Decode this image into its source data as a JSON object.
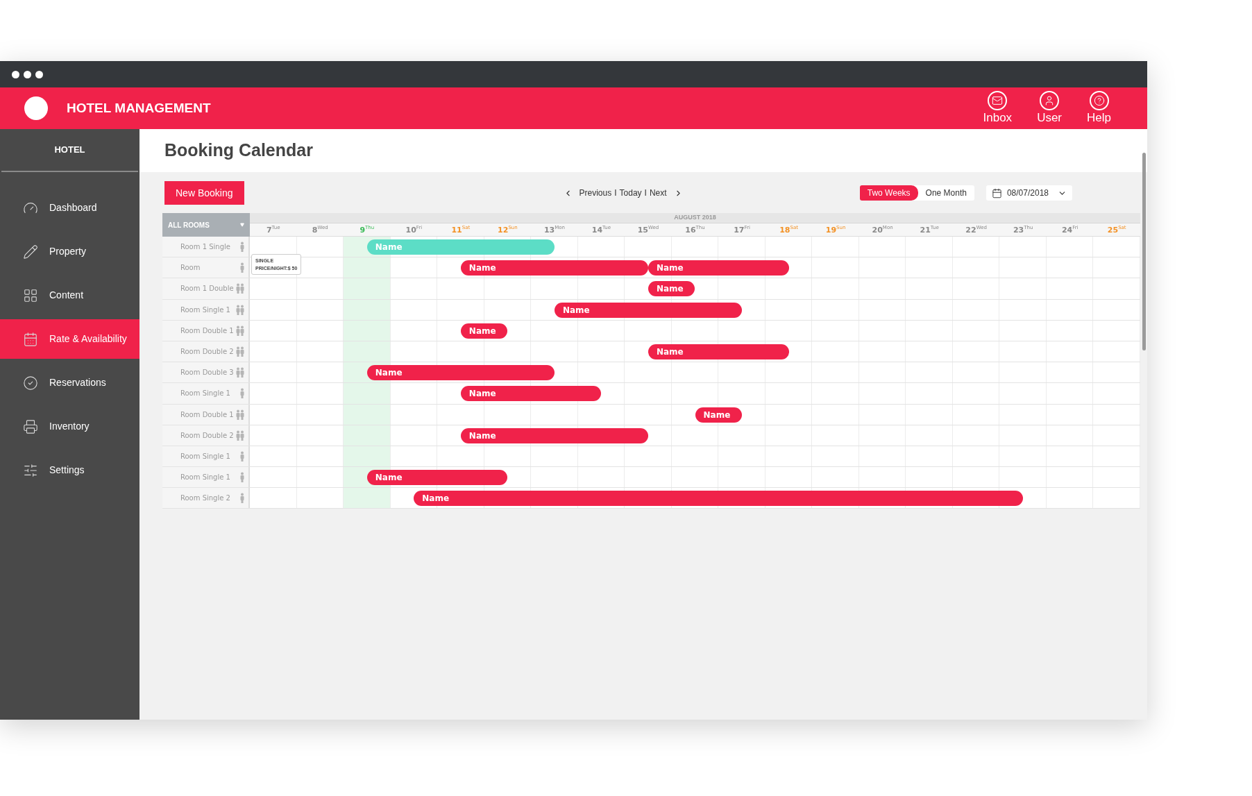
{
  "app": {
    "title": "HOTEL MANAGEMENT"
  },
  "header_actions": [
    {
      "label": "Inbox",
      "kind": "inbox"
    },
    {
      "label": "User",
      "kind": "user"
    },
    {
      "label": "Help",
      "kind": "help"
    }
  ],
  "sidebar": {
    "title": "HOTEL",
    "items": [
      {
        "label": "Dashboard",
        "kind": "dashboard",
        "selected": false
      },
      {
        "label": "Property",
        "kind": "property",
        "selected": false
      },
      {
        "label": "Content",
        "kind": "content",
        "selected": false
      },
      {
        "label": "Rate & Availability",
        "kind": "rate",
        "selected": true
      },
      {
        "label": "Reservations",
        "kind": "reservations",
        "selected": false
      },
      {
        "label": "Inventory",
        "kind": "inventory",
        "selected": false
      },
      {
        "label": "Settings",
        "kind": "settings",
        "selected": false
      }
    ]
  },
  "page": {
    "title": "Booking Calendar"
  },
  "toolbar": {
    "new_booking": "New Booking",
    "nav": [
      "Previous",
      "Today",
      "Next"
    ],
    "separators": [
      "I",
      "I"
    ],
    "views": [
      {
        "label": "Two Weeks",
        "selected": true
      },
      {
        "label": "One Month",
        "selected": false
      }
    ],
    "date": "08/07/2018"
  },
  "calendar": {
    "rooms_filter": "ALL ROOMS",
    "month": "AUGUST 2018",
    "days": [
      {
        "day": "7",
        "weekday": "Tue",
        "kind": "weekday"
      },
      {
        "day": "8",
        "weekday": "Wed",
        "kind": "weekday"
      },
      {
        "day": "9",
        "weekday": "Thu",
        "kind": "today"
      },
      {
        "day": "10",
        "weekday": "Fri",
        "kind": "weekday"
      },
      {
        "day": "11",
        "weekday": "Sat",
        "kind": "weekend"
      },
      {
        "day": "12",
        "weekday": "Sun",
        "kind": "weekend"
      },
      {
        "day": "13",
        "weekday": "Mon",
        "kind": "weekday"
      },
      {
        "day": "14",
        "weekday": "Tue",
        "kind": "weekday"
      },
      {
        "day": "15",
        "weekday": "Wed",
        "kind": "weekday"
      },
      {
        "day": "16",
        "weekday": "Thu",
        "kind": "weekday"
      },
      {
        "day": "17",
        "weekday": "Fri",
        "kind": "weekday"
      },
      {
        "day": "18",
        "weekday": "Sat",
        "kind": "weekend"
      },
      {
        "day": "19",
        "weekday": "Sun",
        "kind": "weekend"
      },
      {
        "day": "20",
        "weekday": "Mon",
        "kind": "weekday"
      },
      {
        "day": "21",
        "weekday": "Tue",
        "kind": "weekday"
      },
      {
        "day": "22",
        "weekday": "Wed",
        "kind": "weekday"
      },
      {
        "day": "23",
        "weekday": "Thu",
        "kind": "weekday"
      },
      {
        "day": "24",
        "weekday": "Fri",
        "kind": "weekday"
      },
      {
        "day": "25",
        "weekday": "Sat",
        "kind": "weekend"
      }
    ],
    "rows": [
      {
        "room": "Room 1 Single",
        "kind": "single",
        "bookings": [
          {
            "name": "Name",
            "color": "#5cddc6"
          }
        ]
      },
      {
        "room": "Room",
        "kind": "single",
        "bookings": [
          {
            "name": "Name",
            "color": "#f0224a"
          },
          {
            "name": "Name",
            "color": "#f0224a"
          }
        ]
      },
      {
        "room": "Room 1 Double",
        "kind": "double",
        "bookings": [
          {
            "name": "Name",
            "color": "#f0224a"
          }
        ]
      },
      {
        "room": "Room Single 1",
        "kind": "double",
        "bookings": [
          {
            "name": "Name",
            "color": "#f0224a"
          }
        ]
      },
      {
        "room": "Room Double 1",
        "kind": "double",
        "bookings": [
          {
            "name": "Name",
            "color": "#f0224a"
          }
        ]
      },
      {
        "room": "Room Double 2",
        "kind": "double",
        "bookings": [
          {
            "name": "Name",
            "color": "#f0224a"
          }
        ]
      },
      {
        "room": "Room Double 3",
        "kind": "double",
        "bookings": [
          {
            "name": "Name",
            "color": "#f0224a"
          }
        ]
      },
      {
        "room": "Room Single 1",
        "kind": "single",
        "bookings": [
          {
            "name": "Name",
            "color": "#f0224a"
          }
        ]
      },
      {
        "room": "Room Double 1",
        "kind": "double",
        "bookings": [
          {
            "name": "Name",
            "color": "#f0224a"
          }
        ]
      },
      {
        "room": "Room Double 2",
        "kind": "double",
        "bookings": [
          {
            "name": "Name",
            "color": "#f0224a"
          }
        ]
      },
      {
        "room": "Room Single 1",
        "kind": "single",
        "bookings": []
      },
      {
        "room": "Room Single 1",
        "kind": "single",
        "bookings": [
          {
            "name": "Name",
            "color": "#f0224a"
          }
        ]
      },
      {
        "room": "Room Single 2",
        "kind": "single",
        "bookings": [
          {
            "name": "Name",
            "color": "#f0224a"
          }
        ]
      }
    ],
    "tooltip": {
      "lines": [
        "SINGLE",
        "PRICE/NIGHT:$ 50"
      ]
    }
  }
}
